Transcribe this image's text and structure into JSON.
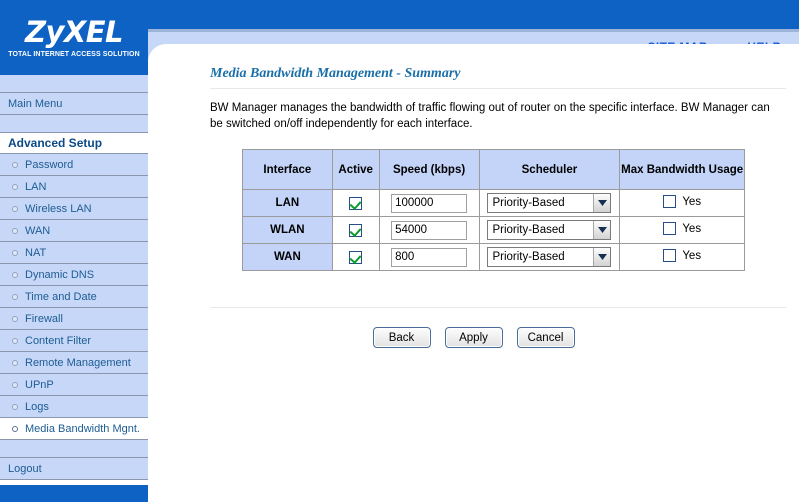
{
  "brand": {
    "logo_text": "ZyXEL",
    "tagline": "TOTAL INTERNET ACCESS SOLUTION",
    "accent_blue": "#0d62c4",
    "panel_blue": "#c7d7f7"
  },
  "topbar": {
    "site_map_label": "SITE MAP",
    "help_label": "HELP"
  },
  "sidebar": {
    "main_menu_label": "Main Menu",
    "section_label": "Advanced Setup",
    "logout_label": "Logout",
    "items": [
      {
        "label": "Password",
        "selected": false
      },
      {
        "label": "LAN",
        "selected": false
      },
      {
        "label": "Wireless LAN",
        "selected": false
      },
      {
        "label": "WAN",
        "selected": false
      },
      {
        "label": "NAT",
        "selected": false
      },
      {
        "label": "Dynamic DNS",
        "selected": false
      },
      {
        "label": "Time and Date",
        "selected": false
      },
      {
        "label": "Firewall",
        "selected": false
      },
      {
        "label": "Content Filter",
        "selected": false
      },
      {
        "label": "Remote Management",
        "selected": false
      },
      {
        "label": "UPnP",
        "selected": false
      },
      {
        "label": "Logs",
        "selected": false
      },
      {
        "label": "Media Bandwidth Mgnt.",
        "selected": true
      }
    ]
  },
  "main": {
    "title": "Media Bandwidth Management - Summary",
    "description": "BW Manager manages the bandwidth of traffic flowing out of router on the specific interface. BW Manager can be switched on/off independently for each interface.",
    "table": {
      "columns": [
        "Interface",
        "Active",
        "Speed (kbps)",
        "Scheduler",
        "Max Bandwidth Usage"
      ],
      "rows": [
        {
          "interface": "LAN",
          "active": true,
          "speed": "100000",
          "scheduler": "Priority-Based",
          "max_bandwidth_usage": false,
          "max_bandwidth_label": "Yes"
        },
        {
          "interface": "WLAN",
          "active": true,
          "speed": "54000",
          "scheduler": "Priority-Based",
          "max_bandwidth_usage": false,
          "max_bandwidth_label": "Yes"
        },
        {
          "interface": "WAN",
          "active": true,
          "speed": "800",
          "scheduler": "Priority-Based",
          "max_bandwidth_usage": false,
          "max_bandwidth_label": "Yes"
        }
      ]
    },
    "buttons": {
      "back": "Back",
      "apply": "Apply",
      "cancel": "Cancel"
    }
  }
}
